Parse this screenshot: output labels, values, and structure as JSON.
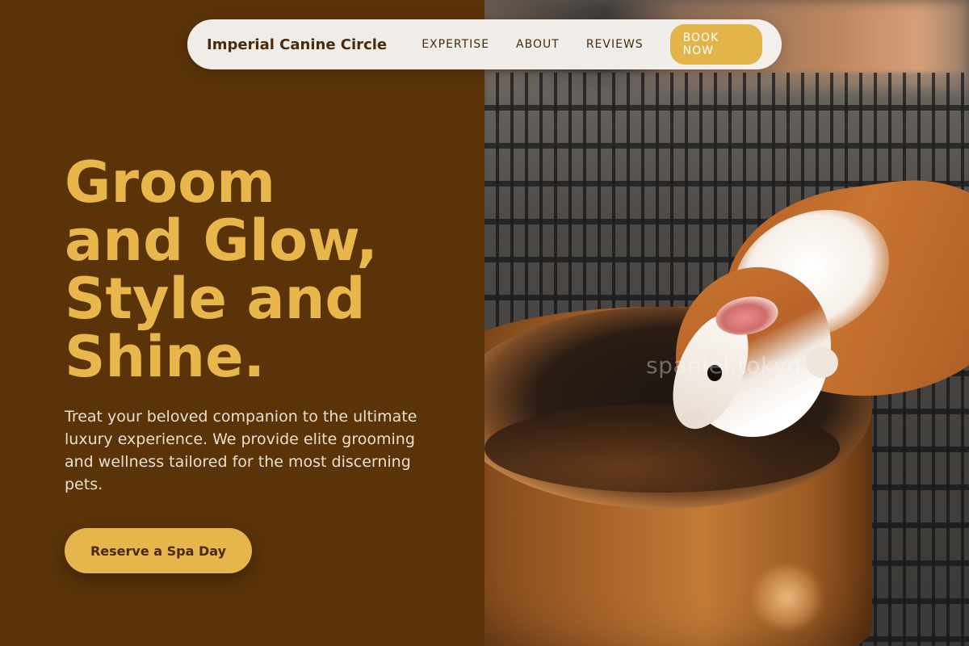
{
  "colors": {
    "background": "#5a3309",
    "accent": "#e9b64b",
    "button": "#e6b54c",
    "nav_bg": "#f7f4f0",
    "text_dark": "#4a2a0c",
    "text_light": "#eadfce"
  },
  "nav": {
    "brand": "Imperial Canine Circle",
    "links": [
      "EXPERTISE",
      "ABOUT",
      "REVIEWS"
    ],
    "book_label": "BOOK NOW"
  },
  "hero": {
    "title_lines": [
      "Groom",
      "and Glow,",
      "Style and",
      "Shine."
    ],
    "description": "Treat your beloved companion to the ultimate luxury experience. We provide elite grooming and wellness tailored for the most discerning pets.",
    "cta_label": "Reserve a Spa Day"
  },
  "image": {
    "subject": "guinea-pig-drinking-from-bowl",
    "watermark": "spaniel.tokyo"
  }
}
